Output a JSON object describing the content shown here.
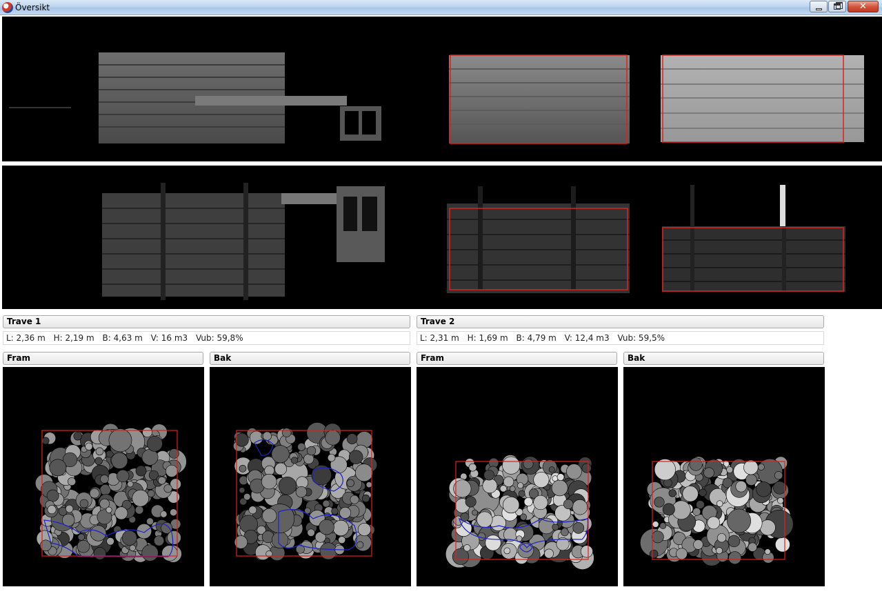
{
  "window": {
    "title": "Översikt",
    "controls": {
      "minimize": "minimize-icon",
      "maximize": "maximize-icon",
      "close": "close-icon"
    }
  },
  "overview": {
    "top_view": "depth-image-top",
    "side_view": "depth-image-side",
    "box_color": "#e0201b",
    "region_color": "#1f22c8"
  },
  "stacks": [
    {
      "title": "Trave 1",
      "info": {
        "L": "L: 2,36 m",
        "H": "H: 2,19 m",
        "B": "B: 4,63 m",
        "V": "V: 16 m3",
        "Vub": "Vub: 59,8%"
      },
      "front_label": "Fram",
      "back_label": "Bak"
    },
    {
      "title": "Trave 2",
      "info": {
        "L": "L: 2,31 m",
        "H": "H: 1,69 m",
        "B": "B: 4,79 m",
        "V": "V: 12,4 m3",
        "Vub": "Vub: 59,5%"
      },
      "front_label": "Fram",
      "back_label": "Bak"
    }
  ]
}
